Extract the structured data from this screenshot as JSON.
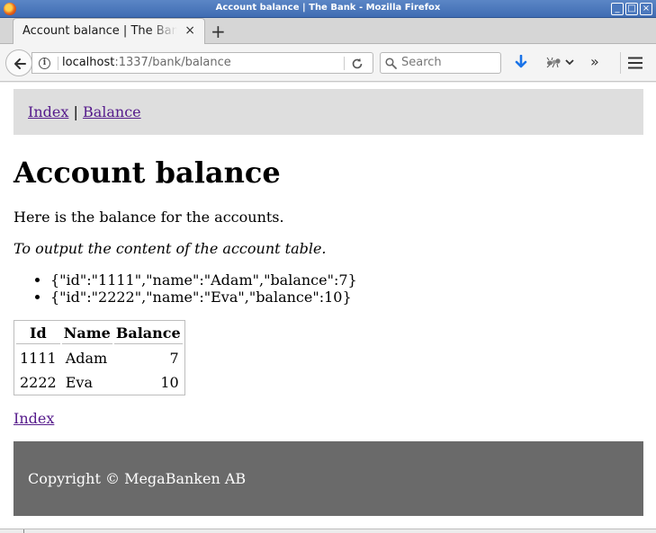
{
  "window": {
    "title": "Account balance | The Bank - Mozilla Firefox",
    "controls": [
      "_",
      "□",
      "×"
    ]
  },
  "tabs": [
    {
      "title": "Account balance | The Bank",
      "close": "×"
    }
  ],
  "new_tab": "+",
  "navbar": {
    "url_host": "localhost",
    "url_rest": ":1337/bank/balance",
    "search_placeholder": "Search",
    "overflow": "»"
  },
  "icons": {
    "back": "back-arrow-icon",
    "info": "info-icon",
    "reload": "reload-icon",
    "search": "magnifier-icon",
    "download": "download-arrow-icon",
    "extension": "ant-icon",
    "menu": "hamburger-icon",
    "accent": "#1a73e8"
  },
  "page": {
    "nav": {
      "index": "Index",
      "separator": "|",
      "balance": "Balance"
    },
    "heading": "Account balance",
    "intro": "Here is the balance for the accounts.",
    "note": "To output the content of the account table.",
    "json_rows": [
      "{\"id\":\"1111\",\"name\":\"Adam\",\"balance\":7}",
      "{\"id\":\"2222\",\"name\":\"Eva\",\"balance\":10}"
    ],
    "table": {
      "headers": [
        "Id",
        "Name",
        "Balance"
      ],
      "rows": [
        [
          "1111",
          "Adam",
          "7"
        ],
        [
          "2222",
          "Eva",
          "10"
        ]
      ]
    },
    "index_link": "Index",
    "footer": "Copyright © MegaBanken AB"
  }
}
